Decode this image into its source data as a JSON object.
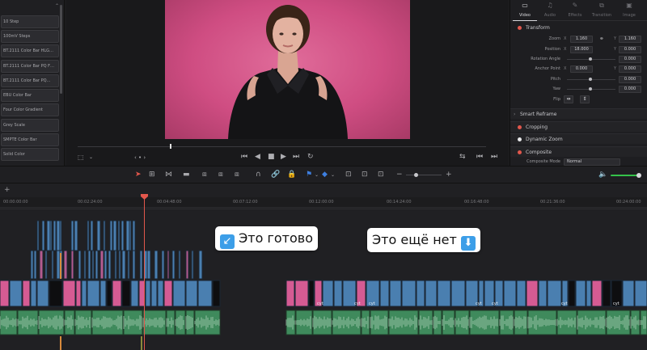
{
  "generators": {
    "items": [
      "10 Step",
      "100mV Steps",
      "BT.2111 Color Bar HLG…",
      "BT.2111 Color Bar PQ F…",
      "BT.2111 Color Bar PQ…",
      "EBU Color Bar",
      "Four Color Gradient",
      "Grey Scale",
      "SMPTE Color Bar",
      "Solid Color"
    ]
  },
  "inspector": {
    "tabs": [
      {
        "label": "Video",
        "icon": "video-icon",
        "active": true
      },
      {
        "label": "Audio",
        "icon": "audio-icon",
        "active": false
      },
      {
        "label": "Effects",
        "icon": "effects-icon",
        "active": false
      },
      {
        "label": "Transition",
        "icon": "transition-icon",
        "active": false
      },
      {
        "label": "Image",
        "icon": "image-icon",
        "active": false
      }
    ],
    "transform": {
      "title": "Transform",
      "zoom_label": "Zoom",
      "zoom_x": "1.160",
      "zoom_y": "1.160",
      "position_label": "Position",
      "position_x": "18.000",
      "position_y": "0.000",
      "rotation_label": "Rotation Angle",
      "rotation_value": "0.000",
      "anchor_label": "Anchor Point",
      "anchor_x": "0.000",
      "anchor_y": "0.000",
      "pitch_label": "Pitch",
      "pitch_value": "0.000",
      "yaw_label": "Yaw",
      "yaw_value": "0.000",
      "flip_label": "Flip"
    },
    "sections": {
      "smart_reframe": "Smart Reframe",
      "cropping": "Cropping",
      "dynamic_zoom": "Dynamic Zoom",
      "composite": "Composite",
      "composite_mode_label": "Composite Mode",
      "composite_mode_value": "Normal"
    }
  },
  "timeline": {
    "timecodes": [
      "00:00:00:00",
      "00:02:24:00",
      "00:04:48:00",
      "00:07:12:00",
      "00:09:36:00",
      "00:12:00:00",
      "00:14:24:00",
      "00:16:48:00",
      "00:19:12:00",
      "00:21:36:00",
      "00:24:00:00"
    ],
    "clip_label": "cyt",
    "annotation_done": "Это готово",
    "annotation_done_emoji": "↙",
    "annotation_not_done": "Это ещё нет",
    "annotation_not_done_emoji": "⬇"
  },
  "colors": {
    "accent_red": "#e2574c",
    "video_clip": "#4a7fb0",
    "audio_clip": "#3f8a5c",
    "pink_thumb": "#d55b93",
    "volume_green": "#35c24a"
  }
}
